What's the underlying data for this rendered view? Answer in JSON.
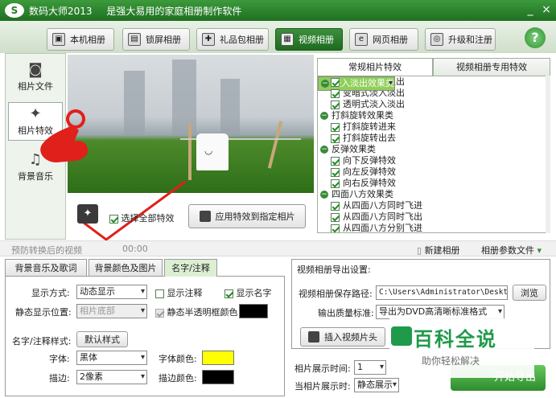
{
  "window": {
    "logo": "S",
    "app_name": "数码大师2013",
    "slogan": "是强大易用的家庭相册制作软件",
    "controls": [
      "_",
      "×"
    ]
  },
  "top_tabs": [
    {
      "label": "本机相册",
      "icon": "photo-album-icon",
      "active": false
    },
    {
      "label": "锁屏相册",
      "icon": "lock-screen-icon",
      "active": false
    },
    {
      "label": "礼品包相册",
      "icon": "gift-icon",
      "active": false
    },
    {
      "label": "视频相册",
      "icon": "film-icon",
      "active": true
    },
    {
      "label": "网页相册",
      "icon": "ie-icon",
      "active": false
    },
    {
      "label": "升级和注册",
      "icon": "upgrade-icon",
      "active": false
    }
  ],
  "help": "?",
  "sidebar": [
    {
      "label": "相片文件",
      "icon": "camera-icon",
      "active": false
    },
    {
      "label": "相片特效",
      "icon": "effects-icon",
      "active": true
    },
    {
      "label": "背景音乐",
      "icon": "music-note-icon",
      "active": false
    }
  ],
  "effects": {
    "select_all_label": "选择全部特效",
    "select_all_checked": true,
    "apply_button": "应用特效到指定相片",
    "tabs": [
      "常规相片特效",
      "视频相册专用特效"
    ],
    "active_tab": 0,
    "groups": [
      {
        "name": "淡入淡出效果类",
        "selected": true,
        "items": [
          "变亮式淡入淡出",
          "变暗式淡入淡出",
          "透明式淡入淡出"
        ]
      },
      {
        "name": "打斜旋转效果类",
        "selected": false,
        "items": [
          "打斜旋转进来",
          "打斜旋转出去"
        ]
      },
      {
        "name": "反弹效果类",
        "selected": false,
        "items": [
          "向下反弹特效",
          "向左反弹特效",
          "向右反弹特效"
        ]
      },
      {
        "name": "四面八方效果类",
        "selected": false,
        "items": [
          "从四面八方同时飞进",
          "从四面八方同时飞出",
          "从四面八方分别飞进"
        ]
      }
    ]
  },
  "status": {
    "hint": "预防转换后的视频",
    "time": "00:00",
    "new_album": "新建相册",
    "album_params": "相册参数文件"
  },
  "bottom_tabs": [
    "背景音乐及歌词",
    "背景颜色及图片",
    "名字/注释"
  ],
  "bottom_active_tab": 2,
  "name_panel": {
    "display_mode_label": "显示方式:",
    "display_mode_value": "动态显示",
    "show_note_label": "显示注释",
    "show_note_checked": false,
    "show_name_label": "显示名字",
    "show_name_checked": true,
    "static_pos_label": "静态显示位置:",
    "static_pos_value": "相片底部",
    "static_bg_label": "静态半透明框颜色",
    "static_bg_checked": true,
    "style_label": "名字/注释样式:",
    "default_style_button": "默认样式",
    "font_label": "字体:",
    "font_value": "黑体",
    "font_color_label": "字体颜色:",
    "font_color": "#ffff00",
    "stroke_label": "描边:",
    "stroke_value": "2像素",
    "stroke_color_label": "描边颜色:",
    "stroke_color": "#000000",
    "static_bg_color": "#000000"
  },
  "export": {
    "title": "视频相册导出设置:",
    "path_label": "视频相册保存路径:",
    "path_value": "C:\\Users\\Administrator\\Desktop",
    "browse_button": "浏览",
    "quality_label": "输出质量标准:",
    "quality_value": "导出为DVD高清晰标准格式",
    "insert_clip_button": "插入视频片头",
    "display_time_label": "相片展示时间:",
    "display_time_value": "1",
    "current_display_label": "当相片展示时:",
    "current_display_value": "静态展示"
  },
  "watermark": {
    "title": "百科全说",
    "subtitle": "助你轻松解决"
  },
  "start_button": "开始导出",
  "colors": {
    "accent": "#2f8a2f",
    "annotation": "#e0201a"
  }
}
